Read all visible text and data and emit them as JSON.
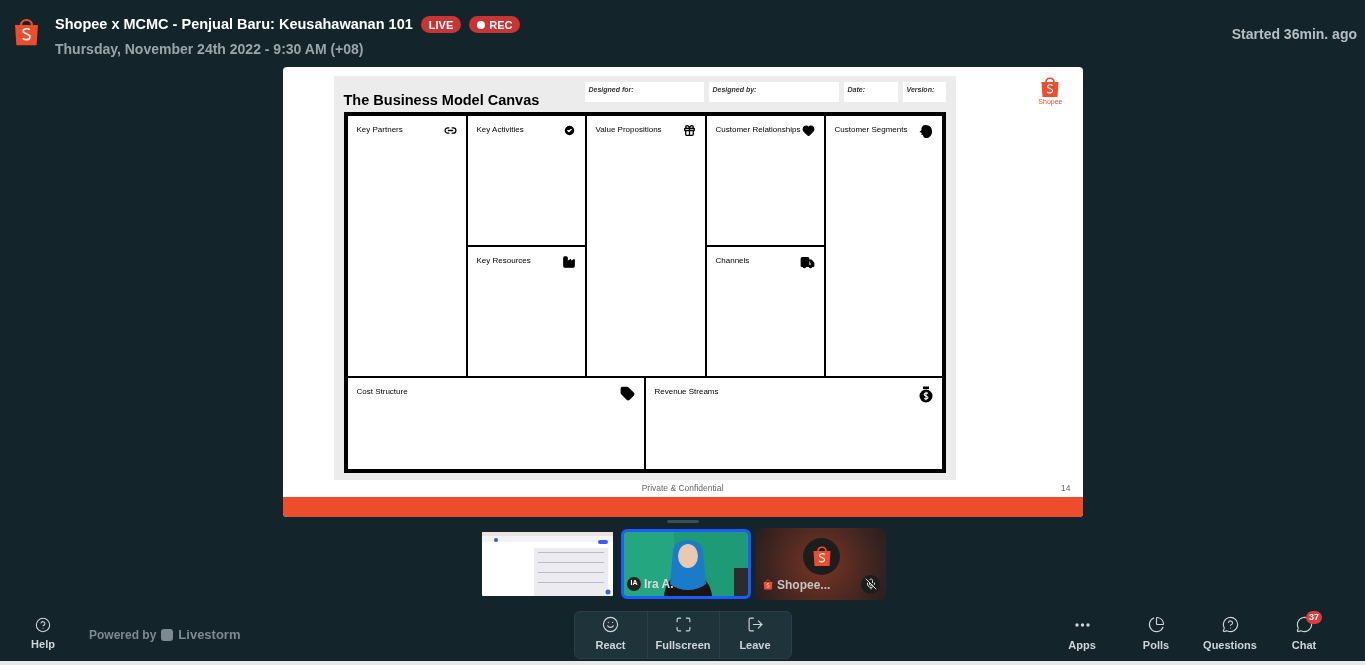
{
  "header": {
    "title": "Shopee x MCMC - Penjual Baru: Keusahawanan 101",
    "badges": [
      {
        "label": "LIVE",
        "kind": "live"
      },
      {
        "label": "REC",
        "kind": "rec"
      }
    ],
    "date": "Thursday, November 24th 2022 - 9:30 AM (+08)",
    "started": "Started 36min. ago"
  },
  "slide": {
    "title": "The Business Model Canvas",
    "fields": [
      "Designed for:",
      "Designed by:",
      "Date:",
      "Version:"
    ],
    "blocks": [
      {
        "label": "Key Partners",
        "kind": "link"
      },
      {
        "label": "Key Activities",
        "kind": "check"
      },
      {
        "label": "Key Resources",
        "kind": "factory"
      },
      {
        "label": "Value Propositions",
        "kind": "gift"
      },
      {
        "label": "Customer Relationships",
        "kind": "heart"
      },
      {
        "label": "Channels",
        "kind": "truck"
      },
      {
        "label": "Customer Segments",
        "kind": "head"
      },
      {
        "label": "Cost Structure",
        "kind": "tag"
      },
      {
        "label": "Revenue Streams",
        "kind": "money"
      }
    ],
    "logo_text": "Shopee",
    "footer": "Private & Confidential",
    "page_number": "14"
  },
  "participants": [
    {
      "kind": "screen",
      "selected": false
    },
    {
      "kind": "camera",
      "initials": "IA",
      "name": "Ira A.",
      "selected": true
    },
    {
      "kind": "avatar",
      "name": "Shopee...",
      "muted": true,
      "selected": false
    }
  ],
  "footer": {
    "help": "Help",
    "powered": "Powered by",
    "brand": "Livestorm",
    "controls": [
      {
        "label": "React",
        "kind": "smile"
      },
      {
        "label": "Fullscreen",
        "kind": "fullscreen"
      },
      {
        "label": "Leave",
        "kind": "leave"
      }
    ],
    "apps": [
      {
        "label": "Apps",
        "kind": "dots"
      },
      {
        "label": "Polls",
        "kind": "poll"
      },
      {
        "label": "Questions",
        "kind": "question"
      },
      {
        "label": "Chat",
        "kind": "chat",
        "badge": "37"
      }
    ]
  }
}
